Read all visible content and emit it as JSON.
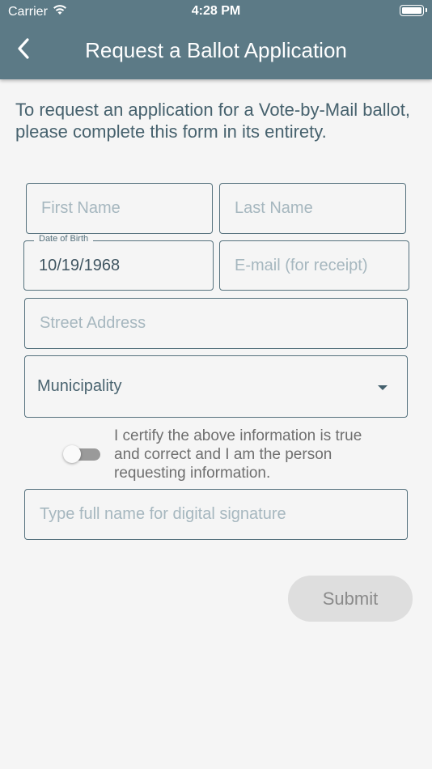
{
  "status_bar": {
    "carrier": "Carrier",
    "time": "4:28 PM"
  },
  "header": {
    "title": "Request a Ballot Application",
    "back_icon": "chevron-left-icon"
  },
  "intro_text": "To request an application for a Vote-by-Mail ballot, please complete this form in its entirety.",
  "form": {
    "first_name": {
      "placeholder": "First Name",
      "value": ""
    },
    "last_name": {
      "placeholder": "Last Name",
      "value": ""
    },
    "date_of_birth": {
      "label": "Date of Birth",
      "value": "10/19/1968"
    },
    "email": {
      "placeholder": "E-mail (for receipt)",
      "value": ""
    },
    "street_address": {
      "placeholder": "Street Address",
      "value": ""
    },
    "municipality": {
      "selected": "Municipality"
    },
    "certify": {
      "checked": false,
      "text": "I certify the above information is true and correct and I am the person requesting information."
    },
    "signature": {
      "placeholder": "Type full name for digital signature",
      "value": ""
    },
    "submit_label": "Submit"
  },
  "colors": {
    "header_bg": "#5c7a86",
    "field_border": "#55717d",
    "placeholder": "#a6b7bf",
    "submit_bg": "#dedede"
  }
}
